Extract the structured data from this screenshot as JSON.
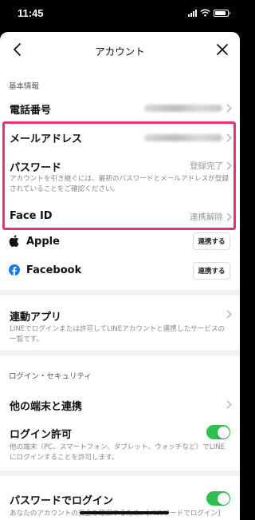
{
  "status_bar": {
    "time": "11:45",
    "battery_level": 0.85
  },
  "header": {
    "title": "アカウント",
    "back_icon": "chevron-left-icon",
    "close_icon": "close-icon"
  },
  "basic_info": {
    "section_label": "基本情報",
    "phone_label": "電話番号",
    "email_label": "メールアドレス",
    "password_label": "パスワード",
    "password_status": "登録完了",
    "password_desc": "アカウントを引き継ぐには、最新のパスワードとメールアドレスが登録されていることをご確認ください。"
  },
  "face_id": {
    "label": "Face ID",
    "status": "連携解除"
  },
  "apple": {
    "label": "Apple",
    "button": "連携する",
    "icon": "apple-icon"
  },
  "facebook": {
    "label": "Facebook",
    "button": "連携する",
    "icon": "facebook-icon",
    "color": "#1877f2"
  },
  "linked_apps": {
    "label": "連動アプリ",
    "desc": "LINEでログインまたは許可してLINEアカウントと連携したサービスの一覧です。"
  },
  "login_security": {
    "section_label": "ログイン・セキュリティ",
    "other_devices_label": "他の端末と連携",
    "login_permission_label": "ログイン許可",
    "login_permission_on": true,
    "login_permission_desc": "他の端末（PC、スマートフォン、タブレット、ウォッチなど）でLINEにログインすることを許可します。",
    "password_login_label": "パスワードでログイン",
    "password_login_on": true,
    "password_login_desc": "あなたのアカウントの安全を確保するため、[パスワードでログイン]"
  },
  "colors": {
    "highlight": "#e8336f",
    "toggle_on": "#30c04f"
  }
}
